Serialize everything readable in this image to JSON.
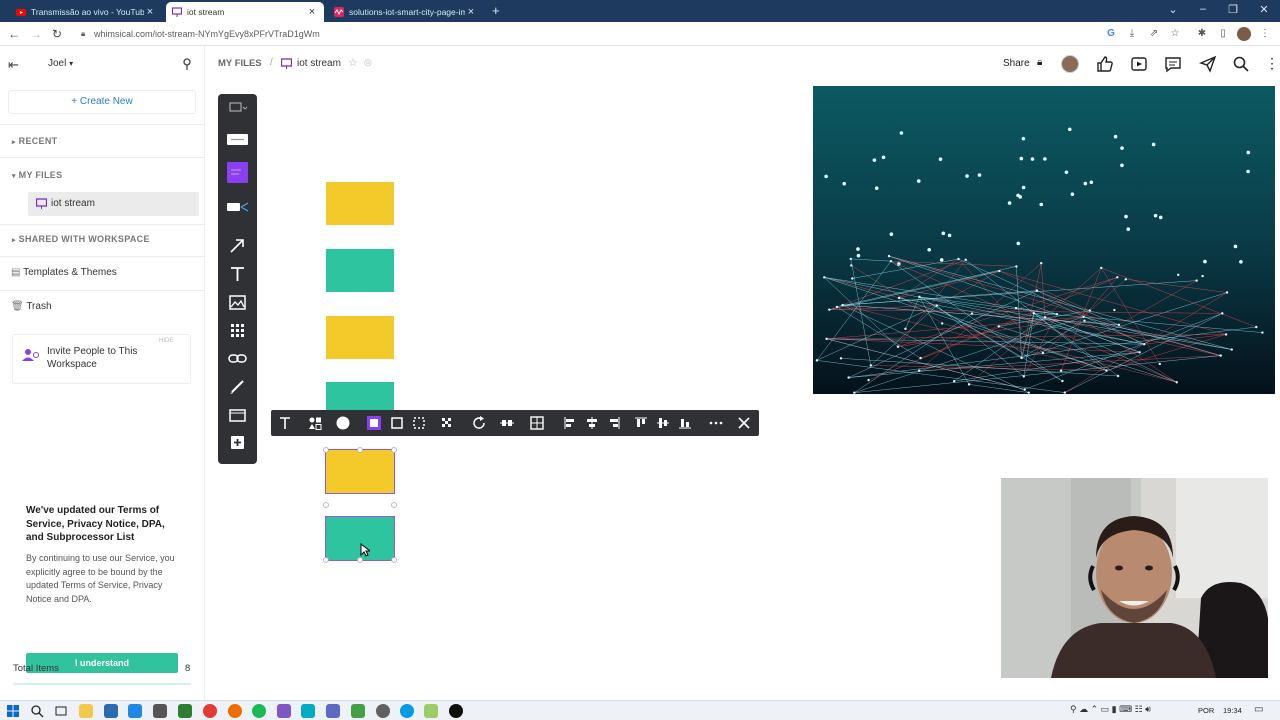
{
  "browser": {
    "tabs": [
      {
        "label": "Transmissão ao vivo - YouTube S",
        "icon": "youtube-icon",
        "color": "#ff0000",
        "active": false
      },
      {
        "label": "iot stream",
        "icon": "whimsical-board-icon",
        "color": "#7b2fbf",
        "active": true
      },
      {
        "label": "solutions-iot-smart-city-page-im",
        "icon": "wave-icon",
        "color": "#e0245e",
        "active": false
      }
    ],
    "new_tab": "+",
    "url": "whimsical.com/iot-stream-NYmYgEvy8xPFrVTraD1gWm"
  },
  "sidebar": {
    "user": "Joel",
    "create_new": "Create New",
    "recent": "RECENT",
    "my_files": "MY FILES",
    "file_item": "iot stream",
    "shared": "SHARED WITH WORKSPACE",
    "templates": "Templates & Themes",
    "trash": "Trash",
    "invite": "Invite People to This Workspace",
    "hide": "HIDE",
    "terms_title": "We've updated our Terms of Service, Privacy Notice, DPA, and Subprocessor List",
    "terms_body": "By continuing to use our Service, you explicitly agree to be bound by the updated Terms of Service, Privacy Notice and DPA.",
    "understand": "I understand",
    "total_items_label": "Total Items",
    "total_items_value": "8"
  },
  "header": {
    "breadcrumb_root": "MY FILES",
    "separator": "/",
    "board_name": "iot stream",
    "share": "Share"
  },
  "canvas": {
    "colors": {
      "yellow": "#f4c92a",
      "teal": "#2ec4a0",
      "selection": "#9b59d0",
      "accent": "#8b3ff2"
    }
  },
  "taskbar": {
    "lang": "POR",
    "time": "19:34"
  }
}
